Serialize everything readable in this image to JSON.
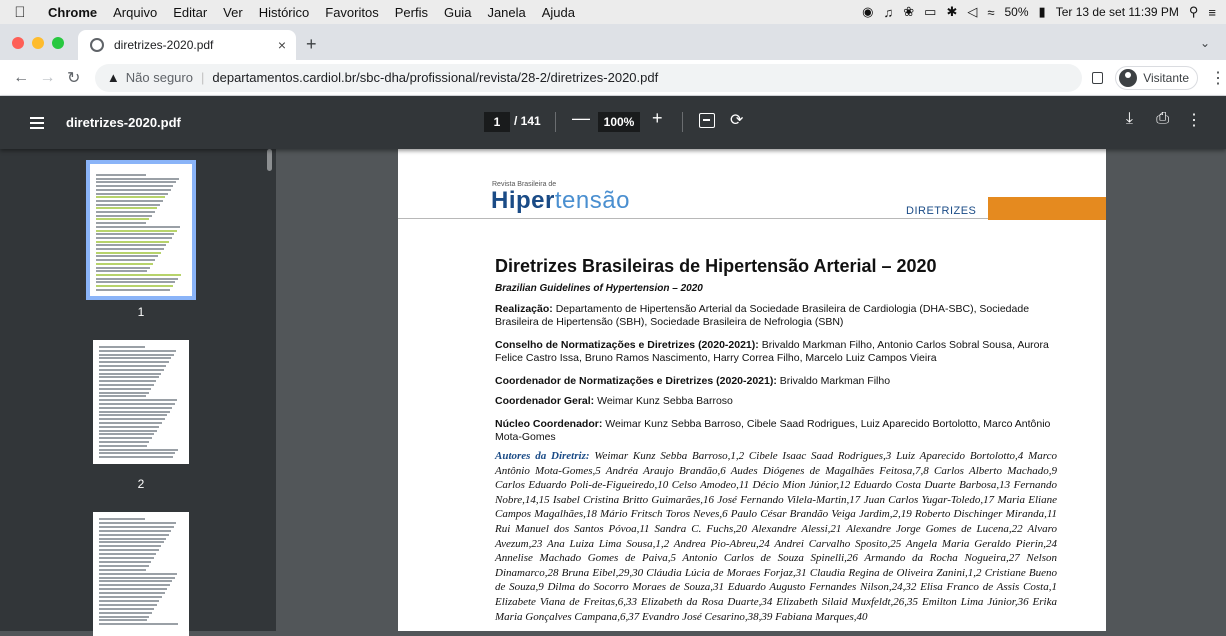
{
  "menubar": {
    "app": "Chrome",
    "items": [
      "Arquivo",
      "Editar",
      "Ver",
      "Histórico",
      "Favoritos",
      "Perfis",
      "Guia",
      "Janela",
      "Ajuda"
    ],
    "battery": "50%",
    "datetime": "Ter 13 de set  11:39 PM"
  },
  "tab": {
    "title": "diretrizes-2020.pdf",
    "close": "×",
    "new": "+"
  },
  "address": {
    "security_label": "Não seguro",
    "url": "departamentos.cardiol.br/sbc-dha/profissional/revista/28-2/diretrizes-2020.pdf",
    "profile": "Visitante"
  },
  "pdf": {
    "title": "diretrizes-2020.pdf",
    "current_page": "1",
    "total_pages": "/ 141",
    "zoom": "100%"
  },
  "sidebar": {
    "thumbnails": [
      "1",
      "2"
    ]
  },
  "document": {
    "journal_small": "Revista Brasileira de",
    "logo_bold": "Hiper",
    "logo_light": "tensão",
    "section": "DIRETRIZES",
    "title": "Diretrizes Brasileiras de Hipertensão Arterial – 2020",
    "subtitle": "Brazilian Guidelines of Hypertension – 2020",
    "realizacao_label": "Realização:",
    "realizacao_text": " Departamento de Hipertensão Arterial da Sociedade Brasileira de Cardiologia (DHA-SBC), Sociedade Brasileira de Hipertensão (SBH), Sociedade Brasileira de Nefrologia (SBN)",
    "conselho_label": "Conselho de Normatizações e Diretrizes (2020-2021):",
    "conselho_text": " Brivaldo Markman Filho, Antonio Carlos Sobral Sousa, Aurora Felice Castro Issa, Bruno Ramos Nascimento, Harry Correa Filho, Marcelo Luiz Campos Vieira",
    "coordenador_label": "Coordenador de Normatizações e Diretrizes (2020-2021):",
    "coordenador_text": " Brivaldo Markman Filho",
    "geral_label": "Coordenador Geral:",
    "geral_text": " Weimar Kunz Sebba Barroso",
    "nucleo_label": "Núcleo Coordenador:",
    "nucleo_text": " Weimar Kunz Sebba Barroso, Cibele Saad Rodrigues, Luiz Aparecido Bortolotto, Marco Antônio Mota-Gomes",
    "autores_label": "Autores da Diretriz:",
    "autores_text": "Weimar Kunz Sebba Barroso,1,2 Cibele Isaac Saad Rodrigues,3 Luiz Aparecido Bortolotto,4 Marco Antônio Mota-Gomes,5 Andréa Araujo Brandão,6 Audes Diógenes de Magalhães Feitosa,7,8 Carlos Alberto Machado,9 Carlos Eduardo Poli-de-Figueiredo,10 Celso Amodeo,11 Décio Mion Júnior,12 Eduardo Costa Duarte Barbosa,13 Fernando Nobre,14,15 Isabel Cristina Britto Guimarães,16 José Fernando Vilela-Martin,17 Juan Carlos Yugar-Toledo,17 Maria Eliane Campos Magalhães,18 Mário Fritsch Toros Neves,6 Paulo César Brandão Veiga Jardim,2,19 Roberto Dischinger Miranda,11 Rui Manuel dos Santos Póvoa,11 Sandra C. Fuchs,20 Alexandre Alessi,21 Alexandre Jorge Gomes de Lucena,22 Alvaro Avezum,23 Ana Luiza Lima Sousa,1,2 Andrea Pio-Abreu,24 Andrei Carvalho Sposito,25 Angela Maria Geraldo Pierin,24 Annelise Machado Gomes de Paiva,5 Antonio Carlos de Souza Spinelli,26 Armando da Rocha Nogueira,27 Nelson Dinamarco,28 Bruna Eibel,29,30 Cláudia Lúcia de Moraes Forjaz,31 Claudia Regina de Oliveira Zanini,1,2 Cristiane Bueno de Souza,9 Dilma do Socorro Moraes de Souza,31 Eduardo Augusto Fernandes Nilson,24,32 Elisa Franco de Assis Costa,1 Elizabete Viana de Freitas,6,33 Elizabeth da Rosa Duarte,34 Elizabeth Silaid Muxfeldt,26,35 Emilton Lima Júnior,36 Erika Maria Gonçalves Campana,6,37 Evandro José Cesarino,38,39 Fabiana Marques,40"
  },
  "colors": {
    "menubar": "#ececec",
    "tabstrip": "#dee1e6",
    "pdf_toolbar": "#323639",
    "viewer_bg": "#525659",
    "selected_thumb": "#8ab4f8",
    "orange_bar": "#e58a1f",
    "logo_blue": "#1a4b86",
    "orcid_green": "#a6ce39"
  },
  "icons": [
    "apple-icon",
    "site-info-icon",
    "back-icon",
    "forward-icon",
    "reload-icon",
    "warning-icon",
    "sidepanel-icon",
    "profile-icon",
    "menu-icon",
    "fit-page-icon",
    "rotate-icon",
    "download-icon",
    "print-icon",
    "more-icon"
  ]
}
